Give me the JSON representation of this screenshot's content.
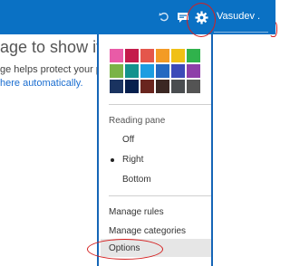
{
  "header": {
    "user_name": "Vasudev ."
  },
  "background": {
    "heading": "age to show it he",
    "line1": "ge helps protect your priv",
    "link": "here automatically."
  },
  "settings_menu": {
    "theme_colors": [
      "#e95ba7",
      "#c41b4b",
      "#e4564b",
      "#f39b25",
      "#f0c015",
      "#30b24c",
      "#7ab347",
      "#13928d",
      "#1c9de1",
      "#2469c1",
      "#3c4ab8",
      "#8e3fa9",
      "#1a3360",
      "#061f4d",
      "#69251e",
      "#3b2723",
      "#4a4d50",
      "#545454"
    ],
    "reading_pane_label": "Reading pane",
    "reading_pane_options": [
      "Off",
      "Right",
      "Bottom"
    ],
    "reading_pane_selected": "Right",
    "manage_rules": "Manage rules",
    "manage_categories": "Manage categories",
    "options": "Options"
  },
  "colors": {
    "topbar": "#0a71c4",
    "annotation": "#d42020",
    "panel_border": "#1565b7"
  }
}
